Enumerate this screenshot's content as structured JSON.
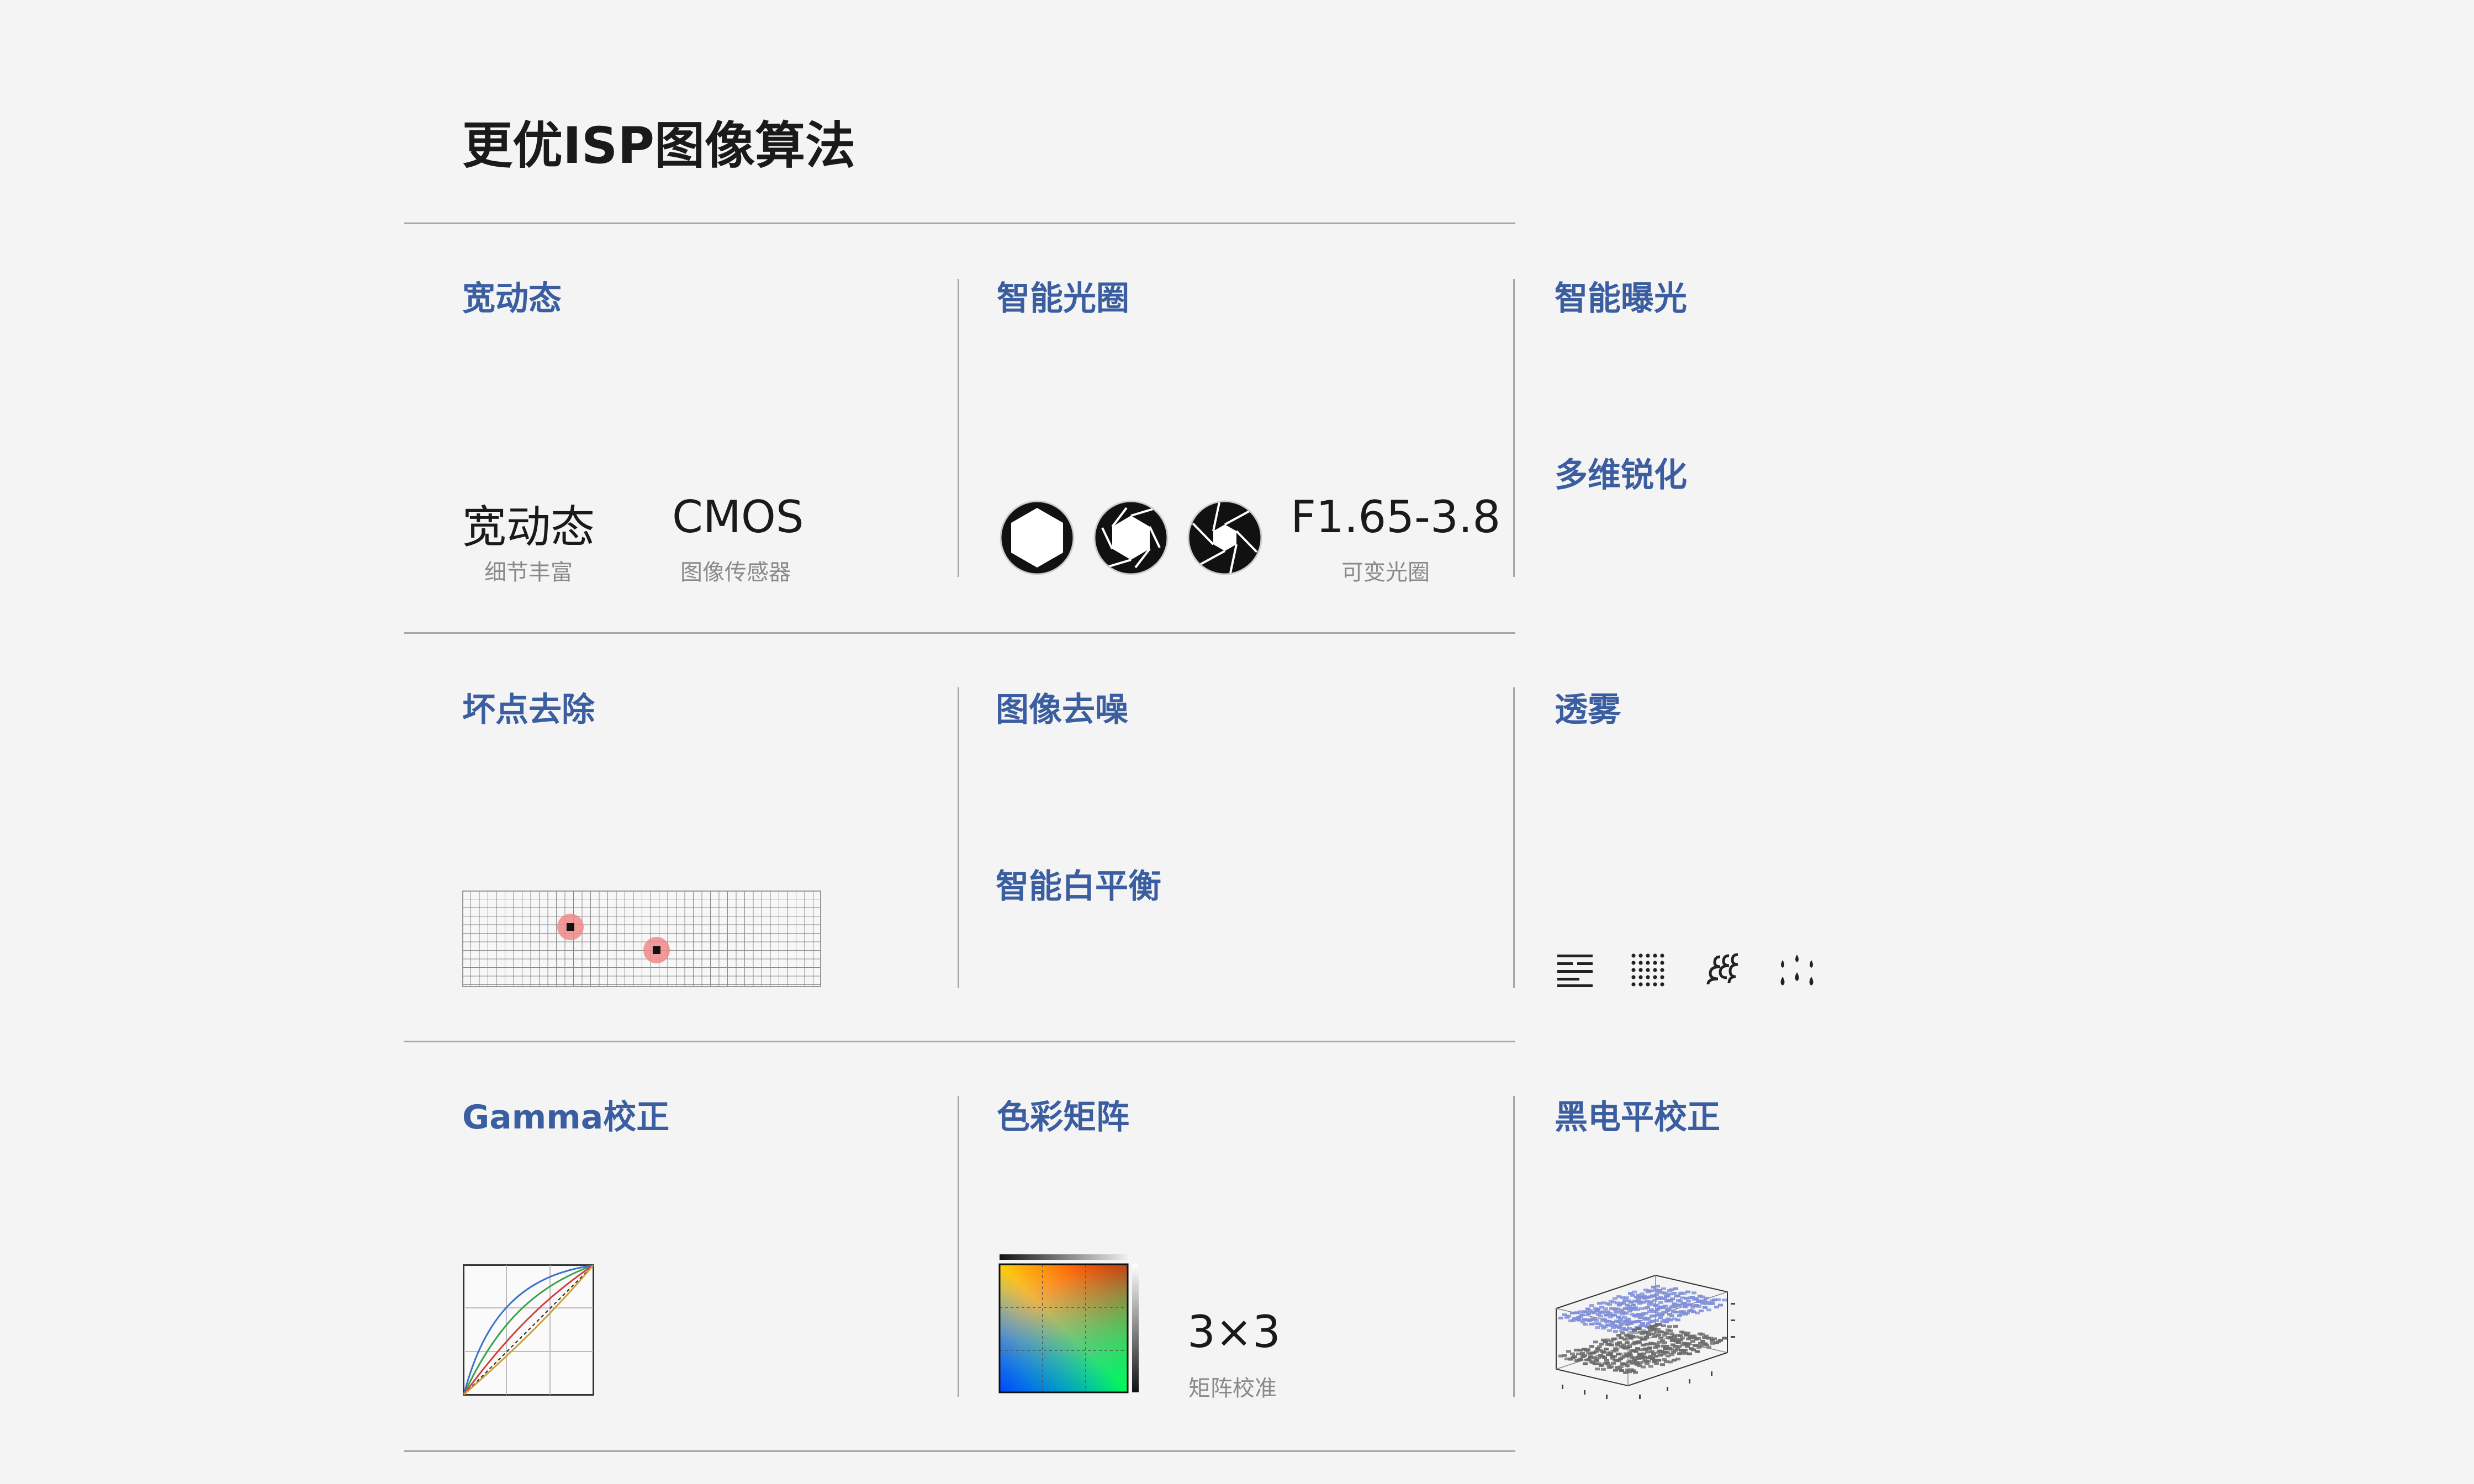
{
  "page_title": "更优ISP图像算法",
  "cells": {
    "wdr": {
      "title": "宽动态",
      "stat1": {
        "value": "宽动态",
        "caption": "细节丰富"
      },
      "stat2": {
        "value": "CMOS",
        "caption": "图像传感器"
      }
    },
    "aperture": {
      "title": "智能光圈",
      "stat": {
        "value": "F1.65-3.8",
        "caption": "可变光圈"
      },
      "icons": [
        "aperture-open-icon",
        "aperture-mid-icon",
        "aperture-closed-icon"
      ]
    },
    "exposure": {
      "title": "智能曝光"
    },
    "sharpen": {
      "title": "多维锐化"
    },
    "dead_pixel": {
      "title": "坏点去除"
    },
    "denoise": {
      "title": "图像去噪"
    },
    "awb": {
      "title": "智能白平衡"
    },
    "defog": {
      "title": "透雾",
      "icons": [
        "fog-lines-icon",
        "dot-grid-icon",
        "haze-waves-icon",
        "rain-drops-icon"
      ]
    },
    "gamma": {
      "title": "Gamma校正"
    },
    "color_matrix": {
      "title": "色彩矩阵",
      "stat": {
        "value": "3×3",
        "caption": "矩阵校准"
      }
    },
    "black_level": {
      "title": "黑电平校正"
    }
  },
  "colors": {
    "accent": "#3a5ea0",
    "divider": "#a8a8a8",
    "background": "#f4f4f4",
    "dead_pixel_highlight": "#f08a8a"
  }
}
